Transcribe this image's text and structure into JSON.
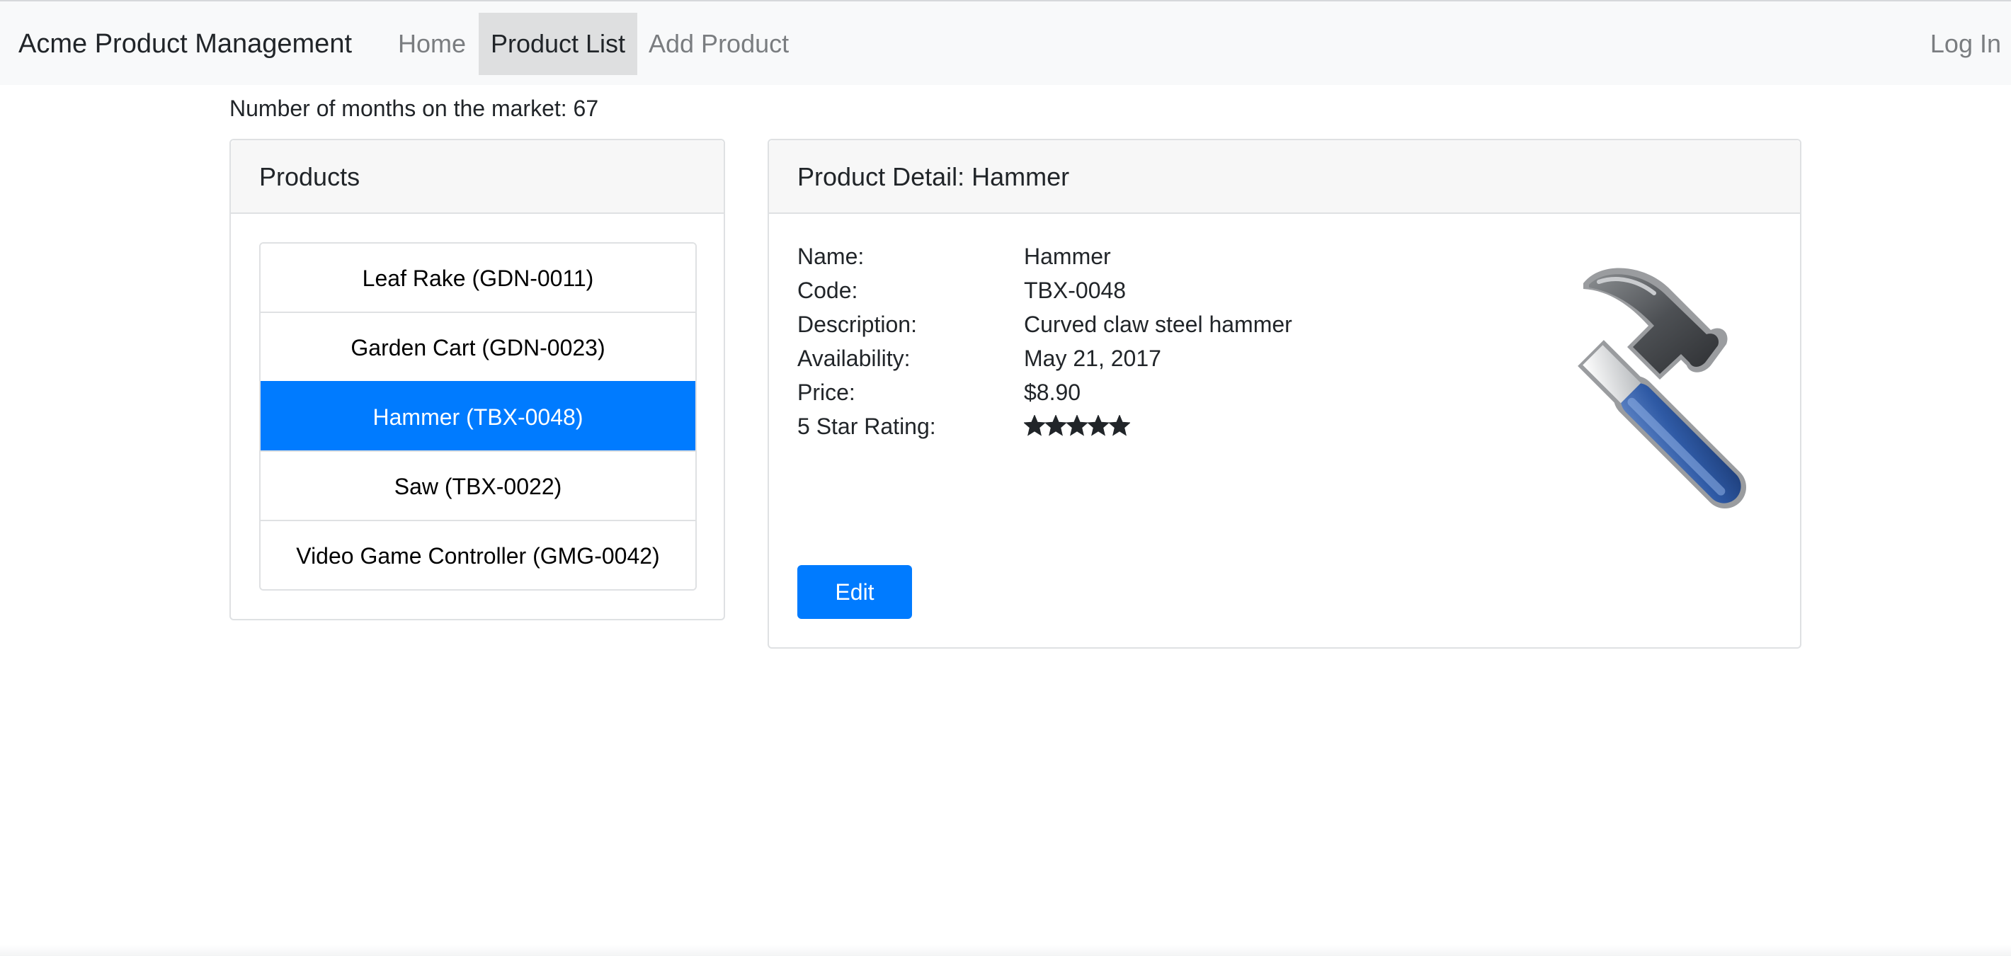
{
  "navbar": {
    "brand": "Acme Product Management",
    "links": {
      "home": "Home",
      "product_list": "Product List",
      "add_product": "Add Product",
      "login": "Log In"
    },
    "active_link": "Product List"
  },
  "months_text": "Number of months on the market: 67",
  "products": {
    "title": "Products",
    "items": [
      {
        "label": "Leaf Rake (GDN-0011)",
        "active": false
      },
      {
        "label": "Garden Cart (GDN-0023)",
        "active": false
      },
      {
        "label": "Hammer (TBX-0048)",
        "active": true
      },
      {
        "label": "Saw (TBX-0022)",
        "active": false
      },
      {
        "label": "Video Game Controller (GMG-0042)",
        "active": false
      }
    ]
  },
  "detail": {
    "title": "Product Detail: Hammer",
    "labels": {
      "name": "Name:",
      "code": "Code:",
      "description": "Description:",
      "availability": "Availability:",
      "price": "Price:",
      "rating": "5 Star Rating:"
    },
    "values": {
      "name": "Hammer",
      "code": "TBX-0048",
      "description": "Curved claw steel hammer",
      "availability": "May 21, 2017",
      "price": "$8.90"
    },
    "rating": {
      "value": 5,
      "max": 5
    },
    "image_icon": "hammer-icon",
    "edit_label": "Edit"
  },
  "colors": {
    "primary": "#007bff",
    "navbar_bg": "#f8f9fa",
    "active_nav_bg": "#dedfe0",
    "card_header_bg": "#f7f7f7",
    "star": "#212529"
  }
}
